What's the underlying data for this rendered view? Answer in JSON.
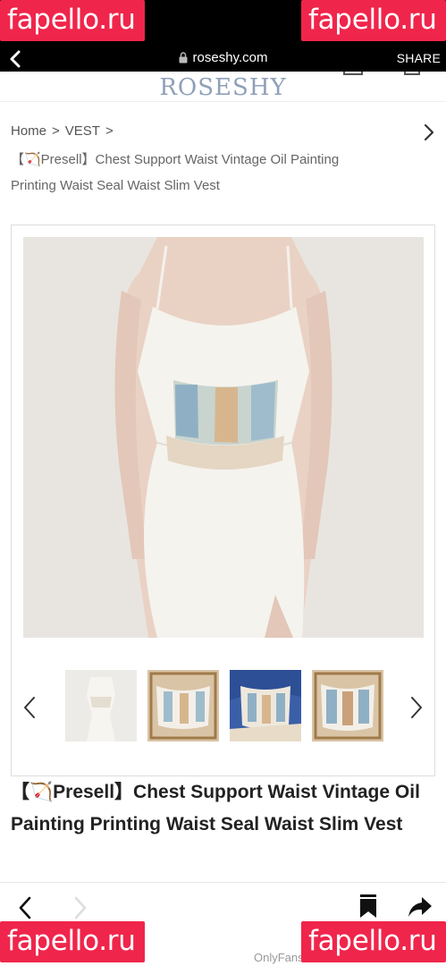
{
  "watermarks": {
    "text": "fapello.ru"
  },
  "browser": {
    "url": "roseshy.com",
    "share_label": "SHARE"
  },
  "site": {
    "logo": "ROSESHY"
  },
  "breadcrumb": {
    "home": "Home",
    "sep": ">",
    "category": "VEST",
    "title": "【🏹Presell】Chest Support Waist Vintage Oil Painting Printing Waist Seal Waist Slim Vest"
  },
  "product": {
    "title": "【🏹Presell】Chest Support Waist Vintage Oil Painting Printing Waist Seal Waist Slim Vest",
    "thumb_count": 4
  },
  "footer": {
    "onlyfans": "OnlyFans"
  },
  "colors": {
    "watermark": "#f0254b",
    "logo": "#8fa0b8"
  }
}
